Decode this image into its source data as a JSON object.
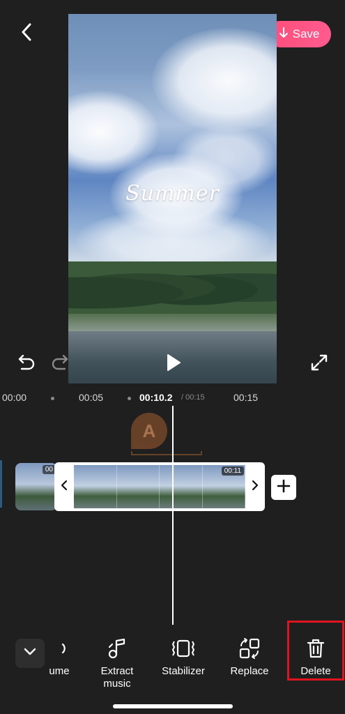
{
  "header": {
    "back_icon": "chevron-left-icon",
    "save_label": "Save",
    "save_icon": "arrow-down-icon",
    "save_gradient": [
      "#ff4e7a",
      "#ff5b8f"
    ]
  },
  "preview": {
    "overlay_text": "Summer"
  },
  "playback": {
    "undo_icon": "undo-icon",
    "redo_icon": "redo-icon",
    "play_icon": "play-icon",
    "fullscreen_icon": "fullscreen-icon"
  },
  "timeline": {
    "ticks": [
      "00:00",
      "00:05",
      "00:15"
    ],
    "current_time": "00:10.2",
    "total_time": "/ 00:15",
    "text_track_label": "A",
    "clip_left_time": "00",
    "clip_selected_time": "00:11"
  },
  "toolbar": {
    "tools": [
      {
        "label": "ume",
        "icon": "volume-icon"
      },
      {
        "label": "Extract\nmusic",
        "icon": "music-note-icon"
      },
      {
        "label": "Stabilizer",
        "icon": "stabilizer-icon"
      },
      {
        "label": "Replace",
        "icon": "replace-icon"
      },
      {
        "label": "Delete",
        "icon": "trash-icon"
      }
    ],
    "collapse_icon": "chevron-down-icon",
    "highlight_color": "#e0141e"
  }
}
